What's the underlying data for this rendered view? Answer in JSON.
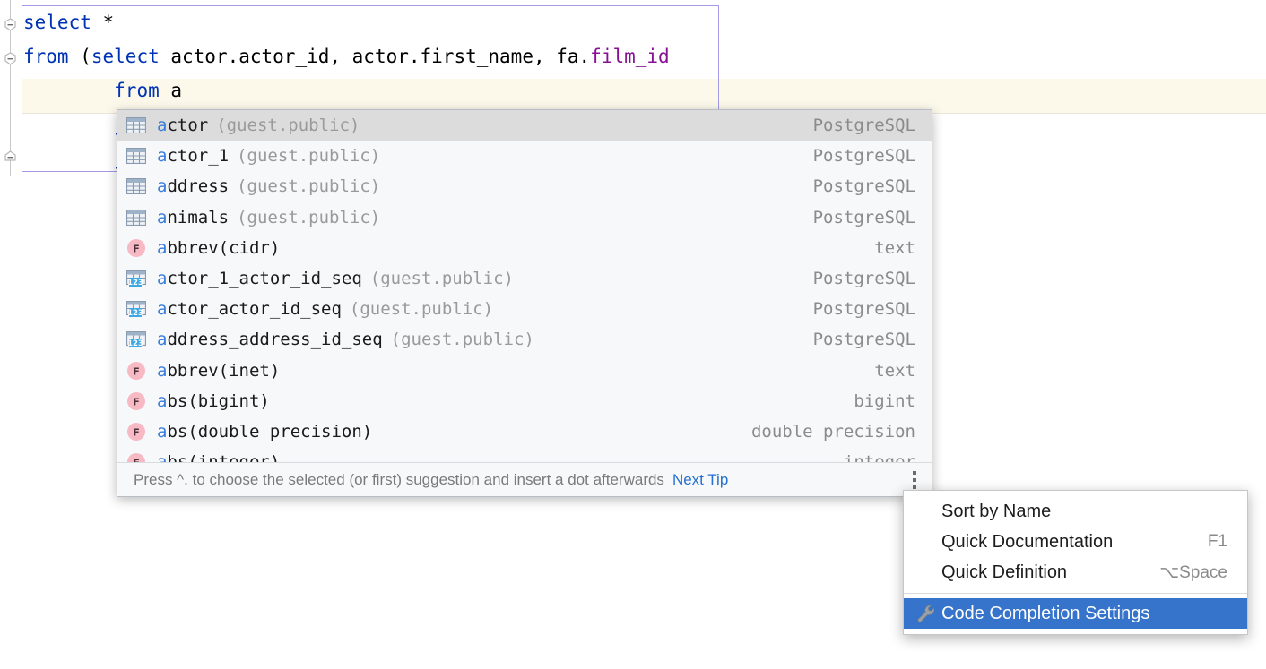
{
  "editor": {
    "code_lines": [
      {
        "segments": [
          {
            "text": "select",
            "kind": "keyword"
          },
          {
            "text": " *",
            "kind": "plain"
          }
        ]
      },
      {
        "segments": [
          {
            "text": "from",
            "kind": "keyword"
          },
          {
            "text": " (",
            "kind": "plain"
          },
          {
            "text": "select",
            "kind": "keyword"
          },
          {
            "text": " actor.actor_id, actor.first_name, fa.",
            "kind": "plain"
          },
          {
            "text": "film_id",
            "kind": "column"
          }
        ]
      },
      {
        "segments": [
          {
            "text": "        ",
            "kind": "plain"
          },
          {
            "text": "from",
            "kind": "keyword"
          },
          {
            "text": " a",
            "kind": "plain"
          }
        ]
      },
      {
        "segments": [
          {
            "text": "        ",
            "kind": "plain"
          },
          {
            "text": "jo",
            "kind": "keyword"
          }
        ]
      },
      {
        "segments": [
          {
            "text": "        ",
            "kind": "plain"
          },
          {
            "text": "jo",
            "kind": "keyword"
          }
        ]
      }
    ],
    "fold_markers": [
      "collapse",
      "collapse",
      "collapse-end"
    ],
    "colors": {
      "keyword": "#0033b3",
      "column": "#871094",
      "caret_line": "#fcf9eb",
      "block_border": "#a39ae8"
    }
  },
  "completion": {
    "items": [
      {
        "prefix": "a",
        "rest": "ctor",
        "schema": "(guest.public)",
        "type": "PostgreSQL",
        "icon": "table-icon",
        "selected": true
      },
      {
        "prefix": "a",
        "rest": "ctor_1",
        "schema": "(guest.public)",
        "type": "PostgreSQL",
        "icon": "table-icon",
        "selected": false
      },
      {
        "prefix": "a",
        "rest": "ddress",
        "schema": "(guest.public)",
        "type": "PostgreSQL",
        "icon": "table-icon",
        "selected": false
      },
      {
        "prefix": "a",
        "rest": "nimals",
        "schema": "(guest.public)",
        "type": "PostgreSQL",
        "icon": "table-icon",
        "selected": false
      },
      {
        "prefix": "a",
        "rest": "bbrev(cidr)",
        "schema": "",
        "type": "text",
        "icon": "function-icon",
        "selected": false
      },
      {
        "prefix": "a",
        "rest": "ctor_1_actor_id_seq",
        "schema": "(guest.public)",
        "type": "PostgreSQL",
        "icon": "sequence-icon",
        "selected": false
      },
      {
        "prefix": "a",
        "rest": "ctor_actor_id_seq",
        "schema": "(guest.public)",
        "type": "PostgreSQL",
        "icon": "sequence-icon",
        "selected": false
      },
      {
        "prefix": "a",
        "rest": "ddress_address_id_seq",
        "schema": "(guest.public)",
        "type": "PostgreSQL",
        "icon": "sequence-icon",
        "selected": false
      },
      {
        "prefix": "a",
        "rest": "bbrev(inet)",
        "schema": "",
        "type": "text",
        "icon": "function-icon",
        "selected": false
      },
      {
        "prefix": "a",
        "rest": "bs(bigint)",
        "schema": "",
        "type": "bigint",
        "icon": "function-icon",
        "selected": false
      },
      {
        "prefix": "a",
        "rest": "bs(double precision)",
        "schema": "",
        "type": "double precision",
        "icon": "function-icon",
        "selected": false
      },
      {
        "prefix": "a",
        "rest": "bs(integer)",
        "schema": "",
        "type": "integer",
        "icon": "function-icon",
        "selected": false
      }
    ],
    "hint": {
      "text": "Press ^. to choose the selected (or first) suggestion and insert a dot afterwards",
      "link": "Next Tip",
      "menu_icon": "kebab-menu-icon"
    }
  },
  "context_menu": {
    "items": [
      {
        "label": "Sort by Name",
        "shortcut": "",
        "icon": "",
        "highlighted": false,
        "separator_after": false
      },
      {
        "label": "Quick Documentation",
        "shortcut": "F1",
        "icon": "",
        "highlighted": false,
        "separator_after": false
      },
      {
        "label": "Quick Definition",
        "shortcut": "⌥Space",
        "icon": "",
        "highlighted": false,
        "separator_after": true
      },
      {
        "label": "Code Completion Settings",
        "shortcut": "",
        "icon": "wrench-icon",
        "highlighted": true,
        "separator_after": false
      }
    ]
  }
}
